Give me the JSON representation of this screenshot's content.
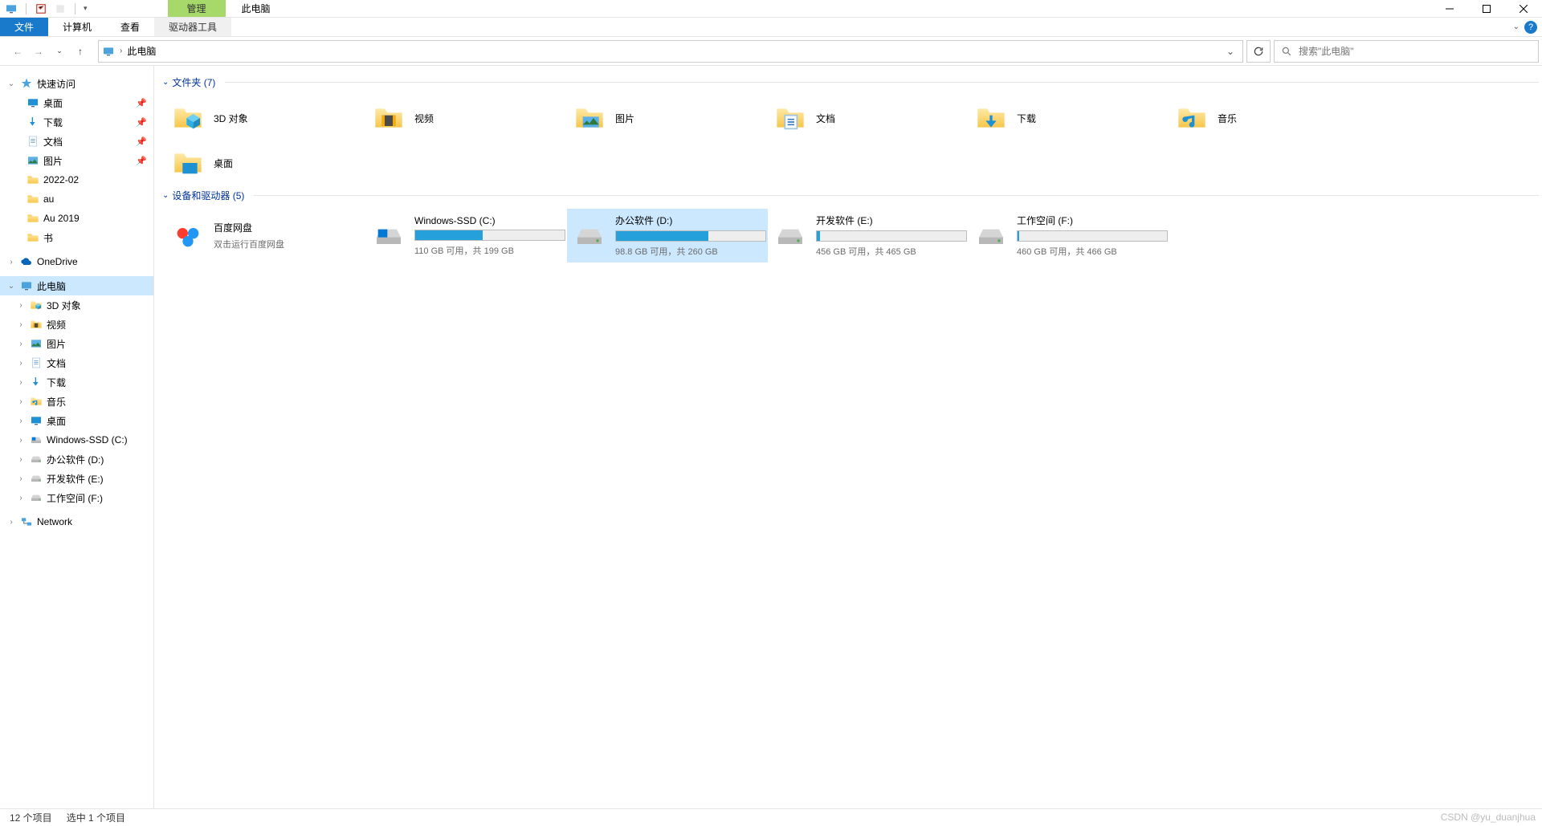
{
  "window": {
    "title": "此电脑",
    "context_tab": "管理"
  },
  "ribbon": {
    "file": "文件",
    "computer": "计算机",
    "view": "查看",
    "drive_tools": "驱动器工具"
  },
  "address": {
    "path": "此电脑"
  },
  "search": {
    "placeholder": "搜索\"此电脑\""
  },
  "sidebar": {
    "quick_access": "快速访问",
    "quick_items": [
      {
        "label": "桌面",
        "icon": "desktop",
        "pin": true
      },
      {
        "label": "下载",
        "icon": "downloads",
        "pin": true
      },
      {
        "label": "文档",
        "icon": "documents",
        "pin": true
      },
      {
        "label": "图片",
        "icon": "pictures",
        "pin": true
      },
      {
        "label": "2022-02",
        "icon": "folder",
        "pin": false
      },
      {
        "label": "au",
        "icon": "folder",
        "pin": false
      },
      {
        "label": "Au 2019",
        "icon": "folder",
        "pin": false
      },
      {
        "label": "书",
        "icon": "folder",
        "pin": false
      }
    ],
    "onedrive": "OneDrive",
    "this_pc": "此电脑",
    "pc_items": [
      {
        "label": "3D 对象",
        "icon": "3d"
      },
      {
        "label": "视频",
        "icon": "video"
      },
      {
        "label": "图片",
        "icon": "pictures"
      },
      {
        "label": "文档",
        "icon": "documents"
      },
      {
        "label": "下载",
        "icon": "downloads"
      },
      {
        "label": "音乐",
        "icon": "music"
      },
      {
        "label": "桌面",
        "icon": "desktop"
      },
      {
        "label": "Windows-SSD (C:)",
        "icon": "drive-os"
      },
      {
        "label": "办公软件 (D:)",
        "icon": "drive"
      },
      {
        "label": "开发软件 (E:)",
        "icon": "drive"
      },
      {
        "label": "工作空间 (F:)",
        "icon": "drive"
      }
    ],
    "network": "Network"
  },
  "groups": {
    "folders_header": "文件夹 (7)",
    "drives_header": "设备和驱动器 (5)"
  },
  "folders": [
    {
      "label": "3D 对象",
      "icon": "3d"
    },
    {
      "label": "视频",
      "icon": "video"
    },
    {
      "label": "图片",
      "icon": "pictures"
    },
    {
      "label": "文档",
      "icon": "documents"
    },
    {
      "label": "下载",
      "icon": "downloads"
    },
    {
      "label": "音乐",
      "icon": "music"
    },
    {
      "label": "桌面",
      "icon": "desktop"
    }
  ],
  "drives": [
    {
      "label": "百度网盘",
      "sub": "双击运行百度网盘",
      "icon": "baidu",
      "bar": false
    },
    {
      "label": "Windows-SSD (C:)",
      "stats": "110 GB 可用，共 199 GB",
      "icon": "drive-os",
      "bar": true,
      "fill": 45
    },
    {
      "label": "办公软件 (D:)",
      "stats": "98.8 GB 可用，共 260 GB",
      "icon": "drive",
      "bar": true,
      "fill": 62,
      "selected": true
    },
    {
      "label": "开发软件 (E:)",
      "stats": "456 GB 可用，共 465 GB",
      "icon": "drive",
      "bar": true,
      "fill": 2
    },
    {
      "label": "工作空间 (F:)",
      "stats": "460 GB 可用，共 466 GB",
      "icon": "drive",
      "bar": true,
      "fill": 1
    }
  ],
  "status": {
    "items": "12 个项目",
    "selected": "选中 1 个项目"
  },
  "watermark": "CSDN @yu_duanjhua"
}
